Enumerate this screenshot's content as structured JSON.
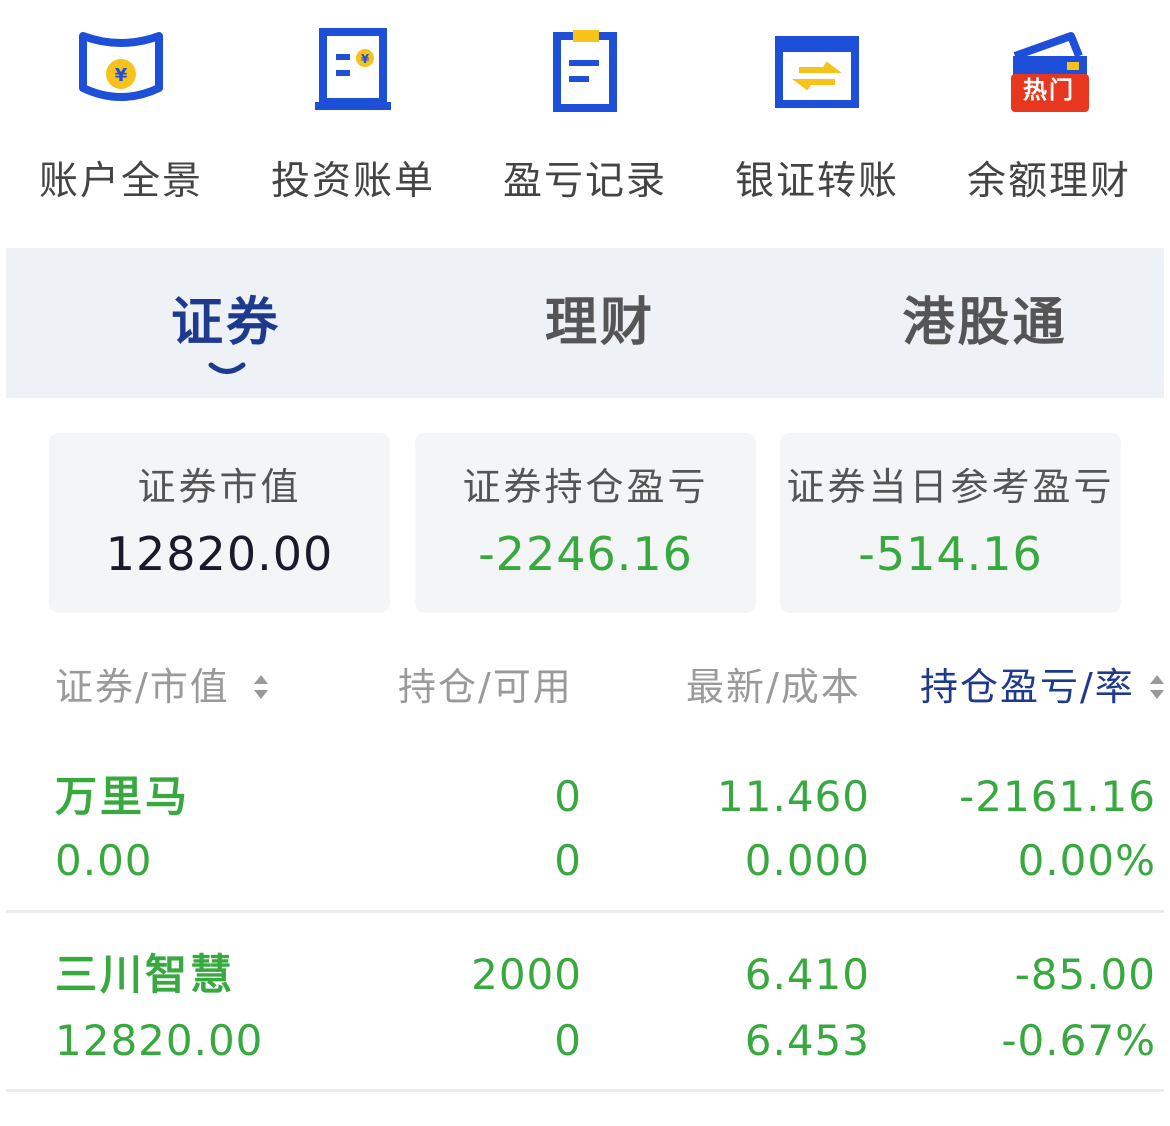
{
  "quick_actions": [
    {
      "label": "账户全景",
      "icon": "account-overview-icon"
    },
    {
      "label": "投资账单",
      "icon": "investment-bill-icon"
    },
    {
      "label": "盈亏记录",
      "icon": "profit-loss-record-icon"
    },
    {
      "label": "银证转账",
      "icon": "bank-transfer-icon"
    },
    {
      "label": "余额理财",
      "icon": "balance-wealth-icon",
      "badge": "热门"
    }
  ],
  "tabs": [
    {
      "label": "证券",
      "active": true
    },
    {
      "label": "理财",
      "active": false
    },
    {
      "label": "港股通",
      "active": false
    }
  ],
  "summary": [
    {
      "label": "证券市值",
      "value": "12820.00"
    },
    {
      "label": "证券持仓盈亏",
      "value": "-2246.16"
    },
    {
      "label": "证券当日参考盈亏",
      "value": "-514.16"
    }
  ],
  "table": {
    "headers": [
      "证券/市值",
      "持仓/可用",
      "最新/成本",
      "持仓盈亏/率"
    ],
    "rows": [
      {
        "name": "万里马",
        "market_value": "0.00",
        "position": "0",
        "available": "0",
        "latest": "11.460",
        "cost": "0.000",
        "pnl": "-2161.16",
        "pnl_rate": "0.00%"
      },
      {
        "name": "三川智慧",
        "market_value": "12820.00",
        "position": "2000",
        "available": "0",
        "latest": "6.410",
        "cost": "6.453",
        "pnl": "-85.00",
        "pnl_rate": "-0.67%"
      }
    ]
  },
  "colors": {
    "accent": "#1d3a8f",
    "icon_blue": "#1e4fd8",
    "icon_yellow": "#f7c21c",
    "loss_green": "#38a93f",
    "badge_red": "#e8371f",
    "tab_bg": "#eef1f6"
  }
}
